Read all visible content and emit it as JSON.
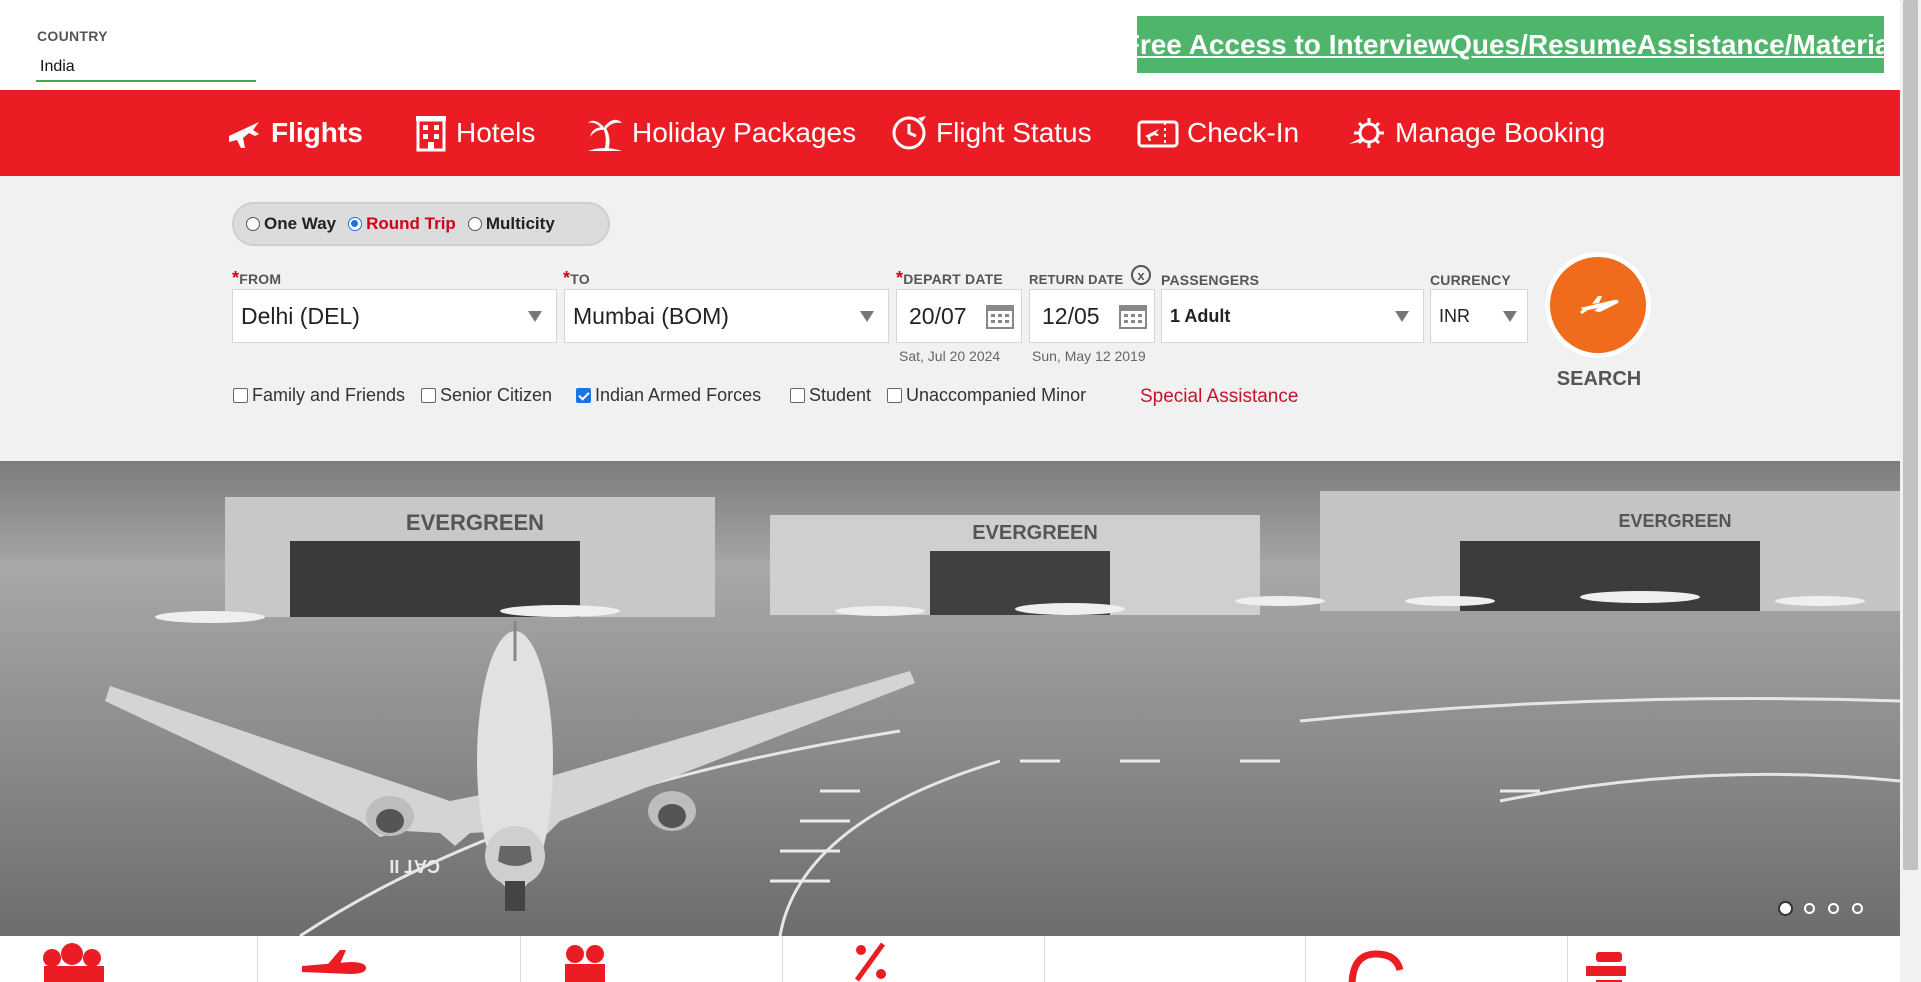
{
  "header": {
    "country_label": "COUNTRY",
    "country_value": "India",
    "promo_text": "Free Access to InterviewQues/ResumeAssistance/Material"
  },
  "nav": {
    "items": [
      {
        "label": "Flights",
        "icon": "airplane-icon",
        "active": true
      },
      {
        "label": "Hotels",
        "icon": "hotel-building-icon",
        "active": false
      },
      {
        "label": "Holiday Packages",
        "icon": "palm-tree-icon",
        "active": false
      },
      {
        "label": "Flight Status",
        "icon": "clock-plane-icon",
        "active": false
      },
      {
        "label": "Check-In",
        "icon": "boarding-pass-icon",
        "active": false
      },
      {
        "label": "Manage Booking",
        "icon": "gear-plane-icon",
        "active": false
      }
    ]
  },
  "trip_type": {
    "options": [
      {
        "label": "One Way",
        "checked": false
      },
      {
        "label": "Round Trip",
        "checked": true
      },
      {
        "label": "Multicity",
        "checked": false
      }
    ]
  },
  "form": {
    "from_label": "FROM",
    "from_value": "Delhi (DEL)",
    "to_label": "TO",
    "to_value": "Mumbai (BOM)",
    "depart_label": "DEPART DATE",
    "depart_value": "20/07",
    "depart_sub": "Sat, Jul 20 2024",
    "return_label": "RETURN DATE",
    "return_value": "12/05",
    "return_sub": "Sun, May 12 2019",
    "clear_symbol": "x",
    "passengers_label": "PASSENGERS",
    "passengers_value": "1 Adult",
    "currency_label": "CURRENCY",
    "currency_value": "INR",
    "required_mark": "*"
  },
  "search": {
    "label": "SEARCH"
  },
  "discounts": [
    {
      "label": "Family and Friends",
      "checked": false
    },
    {
      "label": "Senior Citizen",
      "checked": false
    },
    {
      "label": "Indian Armed Forces",
      "checked": true
    },
    {
      "label": "Student",
      "checked": false
    },
    {
      "label": "Unaccompanied Minor",
      "checked": false
    }
  ],
  "special_assistance": "Special Assistance",
  "carousel": {
    "slide_count": 4,
    "active_index": 0,
    "hangar_signs": [
      "EVERGREEN",
      "EVERGREEN",
      "EVERGREEN"
    ],
    "runway_marking": "CAT II"
  },
  "colors": {
    "brand_red": "#ec1c24",
    "search_orange": "#f06b1c",
    "promo_green": "#4fb56b"
  }
}
